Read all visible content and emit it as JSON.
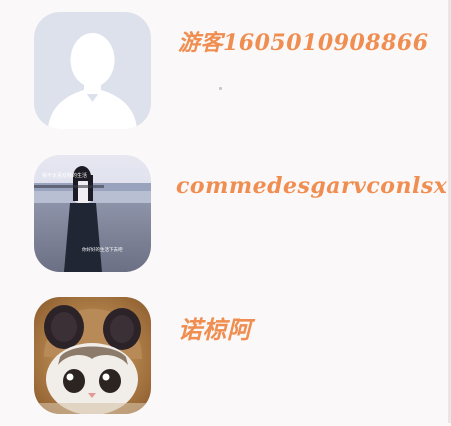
{
  "users": [
    {
      "name": "游客1605010908866",
      "avatar_type": "default-silhouette"
    },
    {
      "name": "commedesgarvconlsx",
      "avatar_type": "photo-girl-seaside",
      "photo_captions": [
        "我不太喜欢我的生活",
        "你好好的生活下去吧"
      ]
    },
    {
      "name": "诺椋阿",
      "avatar_type": "photo-cat-hat"
    }
  ],
  "colors": {
    "name_text": "#ef8e50",
    "background": "#faf8f8",
    "default_avatar_bg": "#dde1ec",
    "default_avatar_silhouette": "#ffffff"
  }
}
